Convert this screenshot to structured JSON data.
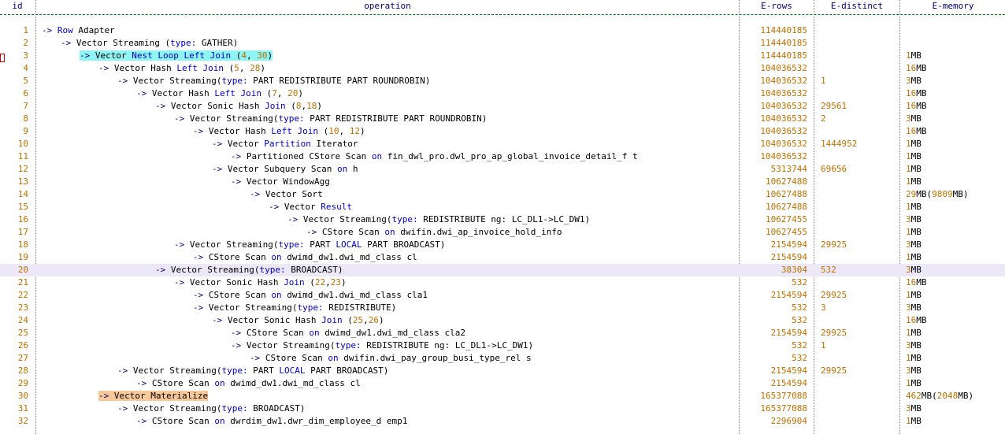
{
  "columns": [
    "id",
    "operation",
    "E-rows",
    "E-distinct",
    "E-memory"
  ],
  "colors": {
    "keyword": "#0000c8",
    "number": "#c07000",
    "highlight_cyan": "#8ff4f4",
    "highlight_orange": "#f8c898",
    "selected_row": "#ece8f8"
  },
  "rows": [
    {
      "id": "1",
      "indent": 0,
      "op": [
        [
          "a",
          "->"
        ],
        [
          "t",
          " "
        ],
        [
          "k",
          "Row"
        ],
        [
          "t",
          " Adapter"
        ]
      ],
      "erows": "114440185",
      "edist": "",
      "emem": []
    },
    {
      "id": "2",
      "indent": 1,
      "op": [
        [
          "a",
          "->"
        ],
        [
          "t",
          " Vector Streaming "
        ],
        [
          "t",
          "("
        ],
        [
          "k",
          "type:"
        ],
        [
          "t",
          " GATHER)"
        ]
      ],
      "erows": "114440185",
      "edist": "",
      "emem": []
    },
    {
      "id": "3",
      "indent": 2,
      "hl": "cyan",
      "op": [
        [
          "a",
          "->"
        ],
        [
          "t",
          " Vector "
        ],
        [
          "k",
          "Nest"
        ],
        [
          "t",
          " "
        ],
        [
          "k",
          "Loop"
        ],
        [
          "t",
          " "
        ],
        [
          "k",
          "Left"
        ],
        [
          "t",
          " "
        ],
        [
          "k",
          "Join"
        ],
        [
          "t",
          " ("
        ],
        [
          "n",
          "4"
        ],
        [
          "t",
          ", "
        ],
        [
          "n",
          "30"
        ],
        [
          "t",
          ")"
        ]
      ],
      "erows": "114440185",
      "edist": "",
      "emem": [
        [
          "n",
          "1"
        ],
        [
          "t",
          "MB"
        ]
      ]
    },
    {
      "id": "4",
      "indent": 3,
      "op": [
        [
          "a",
          "->"
        ],
        [
          "t",
          " Vector Hash "
        ],
        [
          "k",
          "Left"
        ],
        [
          "t",
          " "
        ],
        [
          "k",
          "Join"
        ],
        [
          "t",
          " ("
        ],
        [
          "n",
          "5"
        ],
        [
          "t",
          ", "
        ],
        [
          "n",
          "28"
        ],
        [
          "t",
          ")"
        ]
      ],
      "erows": "104036532",
      "edist": "",
      "emem": [
        [
          "n",
          "16"
        ],
        [
          "t",
          "MB"
        ]
      ]
    },
    {
      "id": "5",
      "indent": 4,
      "op": [
        [
          "a",
          "->"
        ],
        [
          "t",
          " Vector Streaming("
        ],
        [
          "k",
          "type:"
        ],
        [
          "t",
          " PART REDISTRIBUTE PART ROUNDROBIN)"
        ]
      ],
      "erows": "104036532",
      "edist": "1",
      "emem": [
        [
          "n",
          "3"
        ],
        [
          "t",
          "MB"
        ]
      ]
    },
    {
      "id": "6",
      "indent": 5,
      "op": [
        [
          "a",
          "->"
        ],
        [
          "t",
          " Vector Hash "
        ],
        [
          "k",
          "Left"
        ],
        [
          "t",
          " "
        ],
        [
          "k",
          "Join"
        ],
        [
          "t",
          " ("
        ],
        [
          "n",
          "7"
        ],
        [
          "t",
          ", "
        ],
        [
          "n",
          "20"
        ],
        [
          "t",
          ")"
        ]
      ],
      "erows": "104036532",
      "edist": "",
      "emem": [
        [
          "n",
          "16"
        ],
        [
          "t",
          "MB"
        ]
      ]
    },
    {
      "id": "7",
      "indent": 6,
      "op": [
        [
          "a",
          "->"
        ],
        [
          "t",
          " Vector Sonic Hash "
        ],
        [
          "k",
          "Join"
        ],
        [
          "t",
          " ("
        ],
        [
          "n",
          "8"
        ],
        [
          "t",
          ","
        ],
        [
          "n",
          "18"
        ],
        [
          "t",
          ")"
        ]
      ],
      "erows": "104036532",
      "edist": "29561",
      "emem": [
        [
          "n",
          "16"
        ],
        [
          "t",
          "MB"
        ]
      ]
    },
    {
      "id": "8",
      "indent": 7,
      "op": [
        [
          "a",
          "->"
        ],
        [
          "t",
          " Vector Streaming("
        ],
        [
          "k",
          "type:"
        ],
        [
          "t",
          " PART REDISTRIBUTE PART ROUNDROBIN)"
        ]
      ],
      "erows": "104036532",
      "edist": "2",
      "emem": [
        [
          "n",
          "3"
        ],
        [
          "t",
          "MB"
        ]
      ]
    },
    {
      "id": "9",
      "indent": 8,
      "op": [
        [
          "a",
          "->"
        ],
        [
          "t",
          " Vector Hash "
        ],
        [
          "k",
          "Left"
        ],
        [
          "t",
          " "
        ],
        [
          "k",
          "Join"
        ],
        [
          "t",
          " ("
        ],
        [
          "n",
          "10"
        ],
        [
          "t",
          ", "
        ],
        [
          "n",
          "12"
        ],
        [
          "t",
          ")"
        ]
      ],
      "erows": "104036532",
      "edist": "",
      "emem": [
        [
          "n",
          "16"
        ],
        [
          "t",
          "MB"
        ]
      ]
    },
    {
      "id": "10",
      "indent": 9,
      "op": [
        [
          "a",
          "->"
        ],
        [
          "t",
          " Vector "
        ],
        [
          "k",
          "Partition"
        ],
        [
          "t",
          " Iterator"
        ]
      ],
      "erows": "104036532",
      "edist": "1444952",
      "emem": [
        [
          "n",
          "1"
        ],
        [
          "t",
          "MB"
        ]
      ]
    },
    {
      "id": "11",
      "indent": 10,
      "op": [
        [
          "a",
          "->"
        ],
        [
          "t",
          " Partitioned CStore Scan "
        ],
        [
          "k",
          "on"
        ],
        [
          "t",
          " fin_dwl_pro.dwl_pro_ap_global_invoice_detail_f t"
        ]
      ],
      "erows": "104036532",
      "edist": "",
      "emem": [
        [
          "n",
          "1"
        ],
        [
          "t",
          "MB"
        ]
      ]
    },
    {
      "id": "12",
      "indent": 9,
      "op": [
        [
          "a",
          "->"
        ],
        [
          "t",
          " Vector Subquery Scan "
        ],
        [
          "k",
          "on"
        ],
        [
          "t",
          " h"
        ]
      ],
      "erows": "5313744",
      "edist": "69656",
      "emem": [
        [
          "n",
          "1"
        ],
        [
          "t",
          "MB"
        ]
      ]
    },
    {
      "id": "13",
      "indent": 10,
      "op": [
        [
          "a",
          "->"
        ],
        [
          "t",
          " Vector WindowAgg"
        ]
      ],
      "erows": "10627488",
      "edist": "",
      "emem": [
        [
          "n",
          "1"
        ],
        [
          "t",
          "MB"
        ]
      ]
    },
    {
      "id": "14",
      "indent": 11,
      "op": [
        [
          "a",
          "->"
        ],
        [
          "t",
          " Vector Sort"
        ]
      ],
      "erows": "10627488",
      "edist": "",
      "emem": [
        [
          "n",
          "29"
        ],
        [
          "t",
          "MB("
        ],
        [
          "n",
          "9809"
        ],
        [
          "t",
          "MB)"
        ]
      ]
    },
    {
      "id": "15",
      "indent": 12,
      "op": [
        [
          "a",
          "->"
        ],
        [
          "t",
          " Vector "
        ],
        [
          "k",
          "Result"
        ]
      ],
      "erows": "10627488",
      "edist": "",
      "emem": [
        [
          "n",
          "1"
        ],
        [
          "t",
          "MB"
        ]
      ]
    },
    {
      "id": "16",
      "indent": 13,
      "op": [
        [
          "a",
          "->"
        ],
        [
          "t",
          " Vector Streaming("
        ],
        [
          "k",
          "type:"
        ],
        [
          "t",
          " REDISTRIBUTE ng: LC_DL1->LC_DW1)"
        ]
      ],
      "erows": "10627455",
      "edist": "",
      "emem": [
        [
          "n",
          "3"
        ],
        [
          "t",
          "MB"
        ]
      ]
    },
    {
      "id": "17",
      "indent": 14,
      "op": [
        [
          "a",
          "->"
        ],
        [
          "t",
          " CStore Scan "
        ],
        [
          "k",
          "on"
        ],
        [
          "t",
          " dwifin.dwi_ap_invoice_hold_info"
        ]
      ],
      "erows": "10627455",
      "edist": "",
      "emem": [
        [
          "n",
          "1"
        ],
        [
          "t",
          "MB"
        ]
      ]
    },
    {
      "id": "18",
      "indent": 7,
      "op": [
        [
          "a",
          "->"
        ],
        [
          "t",
          " Vector Streaming("
        ],
        [
          "k",
          "type:"
        ],
        [
          "t",
          " PART "
        ],
        [
          "k",
          "LOCAL"
        ],
        [
          "t",
          " PART BROADCAST)"
        ]
      ],
      "erows": "2154594",
      "edist": "29925",
      "emem": [
        [
          "n",
          "3"
        ],
        [
          "t",
          "MB"
        ]
      ]
    },
    {
      "id": "19",
      "indent": 8,
      "op": [
        [
          "a",
          "->"
        ],
        [
          "t",
          " CStore Scan "
        ],
        [
          "k",
          "on"
        ],
        [
          "t",
          " dwimd_dw1.dwi_md_class cl"
        ]
      ],
      "erows": "2154594",
      "edist": "",
      "emem": [
        [
          "n",
          "1"
        ],
        [
          "t",
          "MB"
        ]
      ]
    },
    {
      "id": "20",
      "indent": 6,
      "sel": true,
      "op": [
        [
          "a",
          "->"
        ],
        [
          "t",
          " Vector Streaming("
        ],
        [
          "k",
          "type:"
        ],
        [
          "t",
          " BROADCAST)"
        ]
      ],
      "erows": "38304",
      "edist": "532",
      "emem": [
        [
          "n",
          "3"
        ],
        [
          "t",
          "MB"
        ]
      ]
    },
    {
      "id": "21",
      "indent": 7,
      "op": [
        [
          "a",
          "->"
        ],
        [
          "t",
          " Vector Sonic Hash "
        ],
        [
          "k",
          "Join"
        ],
        [
          "t",
          " ("
        ],
        [
          "n",
          "22"
        ],
        [
          "t",
          ","
        ],
        [
          "n",
          "23"
        ],
        [
          "t",
          ")"
        ]
      ],
      "erows": "532",
      "edist": "",
      "emem": [
        [
          "n",
          "16"
        ],
        [
          "t",
          "MB"
        ]
      ]
    },
    {
      "id": "22",
      "indent": 8,
      "op": [
        [
          "a",
          "->"
        ],
        [
          "t",
          " CStore Scan "
        ],
        [
          "k",
          "on"
        ],
        [
          "t",
          " dwimd_dw1.dwi_md_class cla1"
        ]
      ],
      "erows": "2154594",
      "edist": "29925",
      "emem": [
        [
          "n",
          "1"
        ],
        [
          "t",
          "MB"
        ]
      ]
    },
    {
      "id": "23",
      "indent": 8,
      "op": [
        [
          "a",
          "->"
        ],
        [
          "t",
          " Vector Streaming("
        ],
        [
          "k",
          "type:"
        ],
        [
          "t",
          " REDISTRIBUTE)"
        ]
      ],
      "erows": "532",
      "edist": "3",
      "emem": [
        [
          "n",
          "3"
        ],
        [
          "t",
          "MB"
        ]
      ]
    },
    {
      "id": "24",
      "indent": 9,
      "op": [
        [
          "a",
          "->"
        ],
        [
          "t",
          " Vector Sonic Hash "
        ],
        [
          "k",
          "Join"
        ],
        [
          "t",
          " ("
        ],
        [
          "n",
          "25"
        ],
        [
          "t",
          ","
        ],
        [
          "n",
          "26"
        ],
        [
          "t",
          ")"
        ]
      ],
      "erows": "532",
      "edist": "",
      "emem": [
        [
          "n",
          "16"
        ],
        [
          "t",
          "MB"
        ]
      ]
    },
    {
      "id": "25",
      "indent": 10,
      "op": [
        [
          "a",
          "->"
        ],
        [
          "t",
          " CStore Scan "
        ],
        [
          "k",
          "on"
        ],
        [
          "t",
          " dwimd_dw1.dwi_md_class cla2"
        ]
      ],
      "erows": "2154594",
      "edist": "29925",
      "emem": [
        [
          "n",
          "1"
        ],
        [
          "t",
          "MB"
        ]
      ]
    },
    {
      "id": "26",
      "indent": 10,
      "op": [
        [
          "a",
          "->"
        ],
        [
          "t",
          " Vector Streaming("
        ],
        [
          "k",
          "type:"
        ],
        [
          "t",
          " REDISTRIBUTE ng: LC_DL1->LC_DW1)"
        ]
      ],
      "erows": "532",
      "edist": "1",
      "emem": [
        [
          "n",
          "3"
        ],
        [
          "t",
          "MB"
        ]
      ]
    },
    {
      "id": "27",
      "indent": 11,
      "op": [
        [
          "a",
          "->"
        ],
        [
          "t",
          " CStore Scan "
        ],
        [
          "k",
          "on"
        ],
        [
          "t",
          " dwifin.dwi_pay_group_busi_type_rel s"
        ]
      ],
      "erows": "532",
      "edist": "",
      "emem": [
        [
          "n",
          "1"
        ],
        [
          "t",
          "MB"
        ]
      ]
    },
    {
      "id": "28",
      "indent": 4,
      "op": [
        [
          "a",
          "->"
        ],
        [
          "t",
          " Vector Streaming("
        ],
        [
          "k",
          "type:"
        ],
        [
          "t",
          " PART "
        ],
        [
          "k",
          "LOCAL"
        ],
        [
          "t",
          " PART BROADCAST)"
        ]
      ],
      "erows": "2154594",
      "edist": "29925",
      "emem": [
        [
          "n",
          "3"
        ],
        [
          "t",
          "MB"
        ]
      ]
    },
    {
      "id": "29",
      "indent": 5,
      "op": [
        [
          "a",
          "->"
        ],
        [
          "t",
          " CStore Scan "
        ],
        [
          "k",
          "on"
        ],
        [
          "t",
          " dwimd_dw1.dwi_md_class cl"
        ]
      ],
      "erows": "2154594",
      "edist": "",
      "emem": [
        [
          "n",
          "1"
        ],
        [
          "t",
          "MB"
        ]
      ]
    },
    {
      "id": "30",
      "indent": 3,
      "hl": "orange",
      "op": [
        [
          "a",
          "->"
        ],
        [
          "t",
          " Vector Materialize"
        ]
      ],
      "erows": "165377088",
      "edist": "",
      "emem": [
        [
          "n",
          "462"
        ],
        [
          "t",
          "MB("
        ],
        [
          "n",
          "2048"
        ],
        [
          "t",
          "MB)"
        ]
      ]
    },
    {
      "id": "31",
      "indent": 4,
      "op": [
        [
          "a",
          "->"
        ],
        [
          "t",
          " Vector Streaming("
        ],
        [
          "k",
          "type:"
        ],
        [
          "t",
          " BROADCAST)"
        ]
      ],
      "erows": "165377088",
      "edist": "",
      "emem": [
        [
          "n",
          "3"
        ],
        [
          "t",
          "MB"
        ]
      ]
    },
    {
      "id": "32",
      "indent": 5,
      "op": [
        [
          "a",
          "->"
        ],
        [
          "t",
          " CStore Scan "
        ],
        [
          "k",
          "on"
        ],
        [
          "t",
          " dwrdim_dw1.dwr_dim_employee_d emp1"
        ]
      ],
      "erows": "2296904",
      "edist": "",
      "emem": [
        [
          "n",
          "1"
        ],
        [
          "t",
          "MB"
        ]
      ]
    }
  ]
}
